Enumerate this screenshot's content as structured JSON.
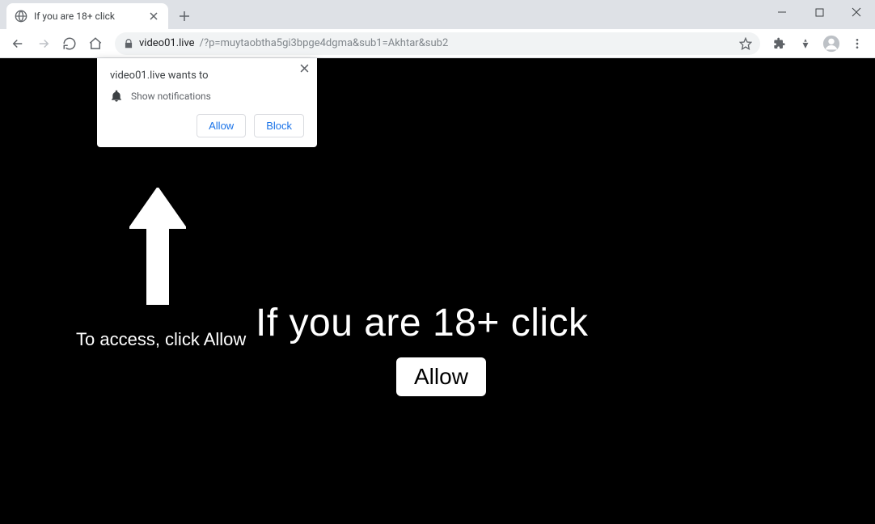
{
  "window": {
    "tab_title": "If you are 18+ click"
  },
  "address": {
    "host": "video01.live",
    "path": "/?p=muytaobtha5gi3bpge4dgma&sub1=Akhtar&sub2"
  },
  "notification_prompt": {
    "title": "video01.live wants to",
    "body": "Show notifications",
    "allow_label": "Allow",
    "block_label": "Block"
  },
  "page": {
    "instruction": "To access, click Allow",
    "headline": "If you are 18+ click",
    "allow_button": "Allow"
  }
}
